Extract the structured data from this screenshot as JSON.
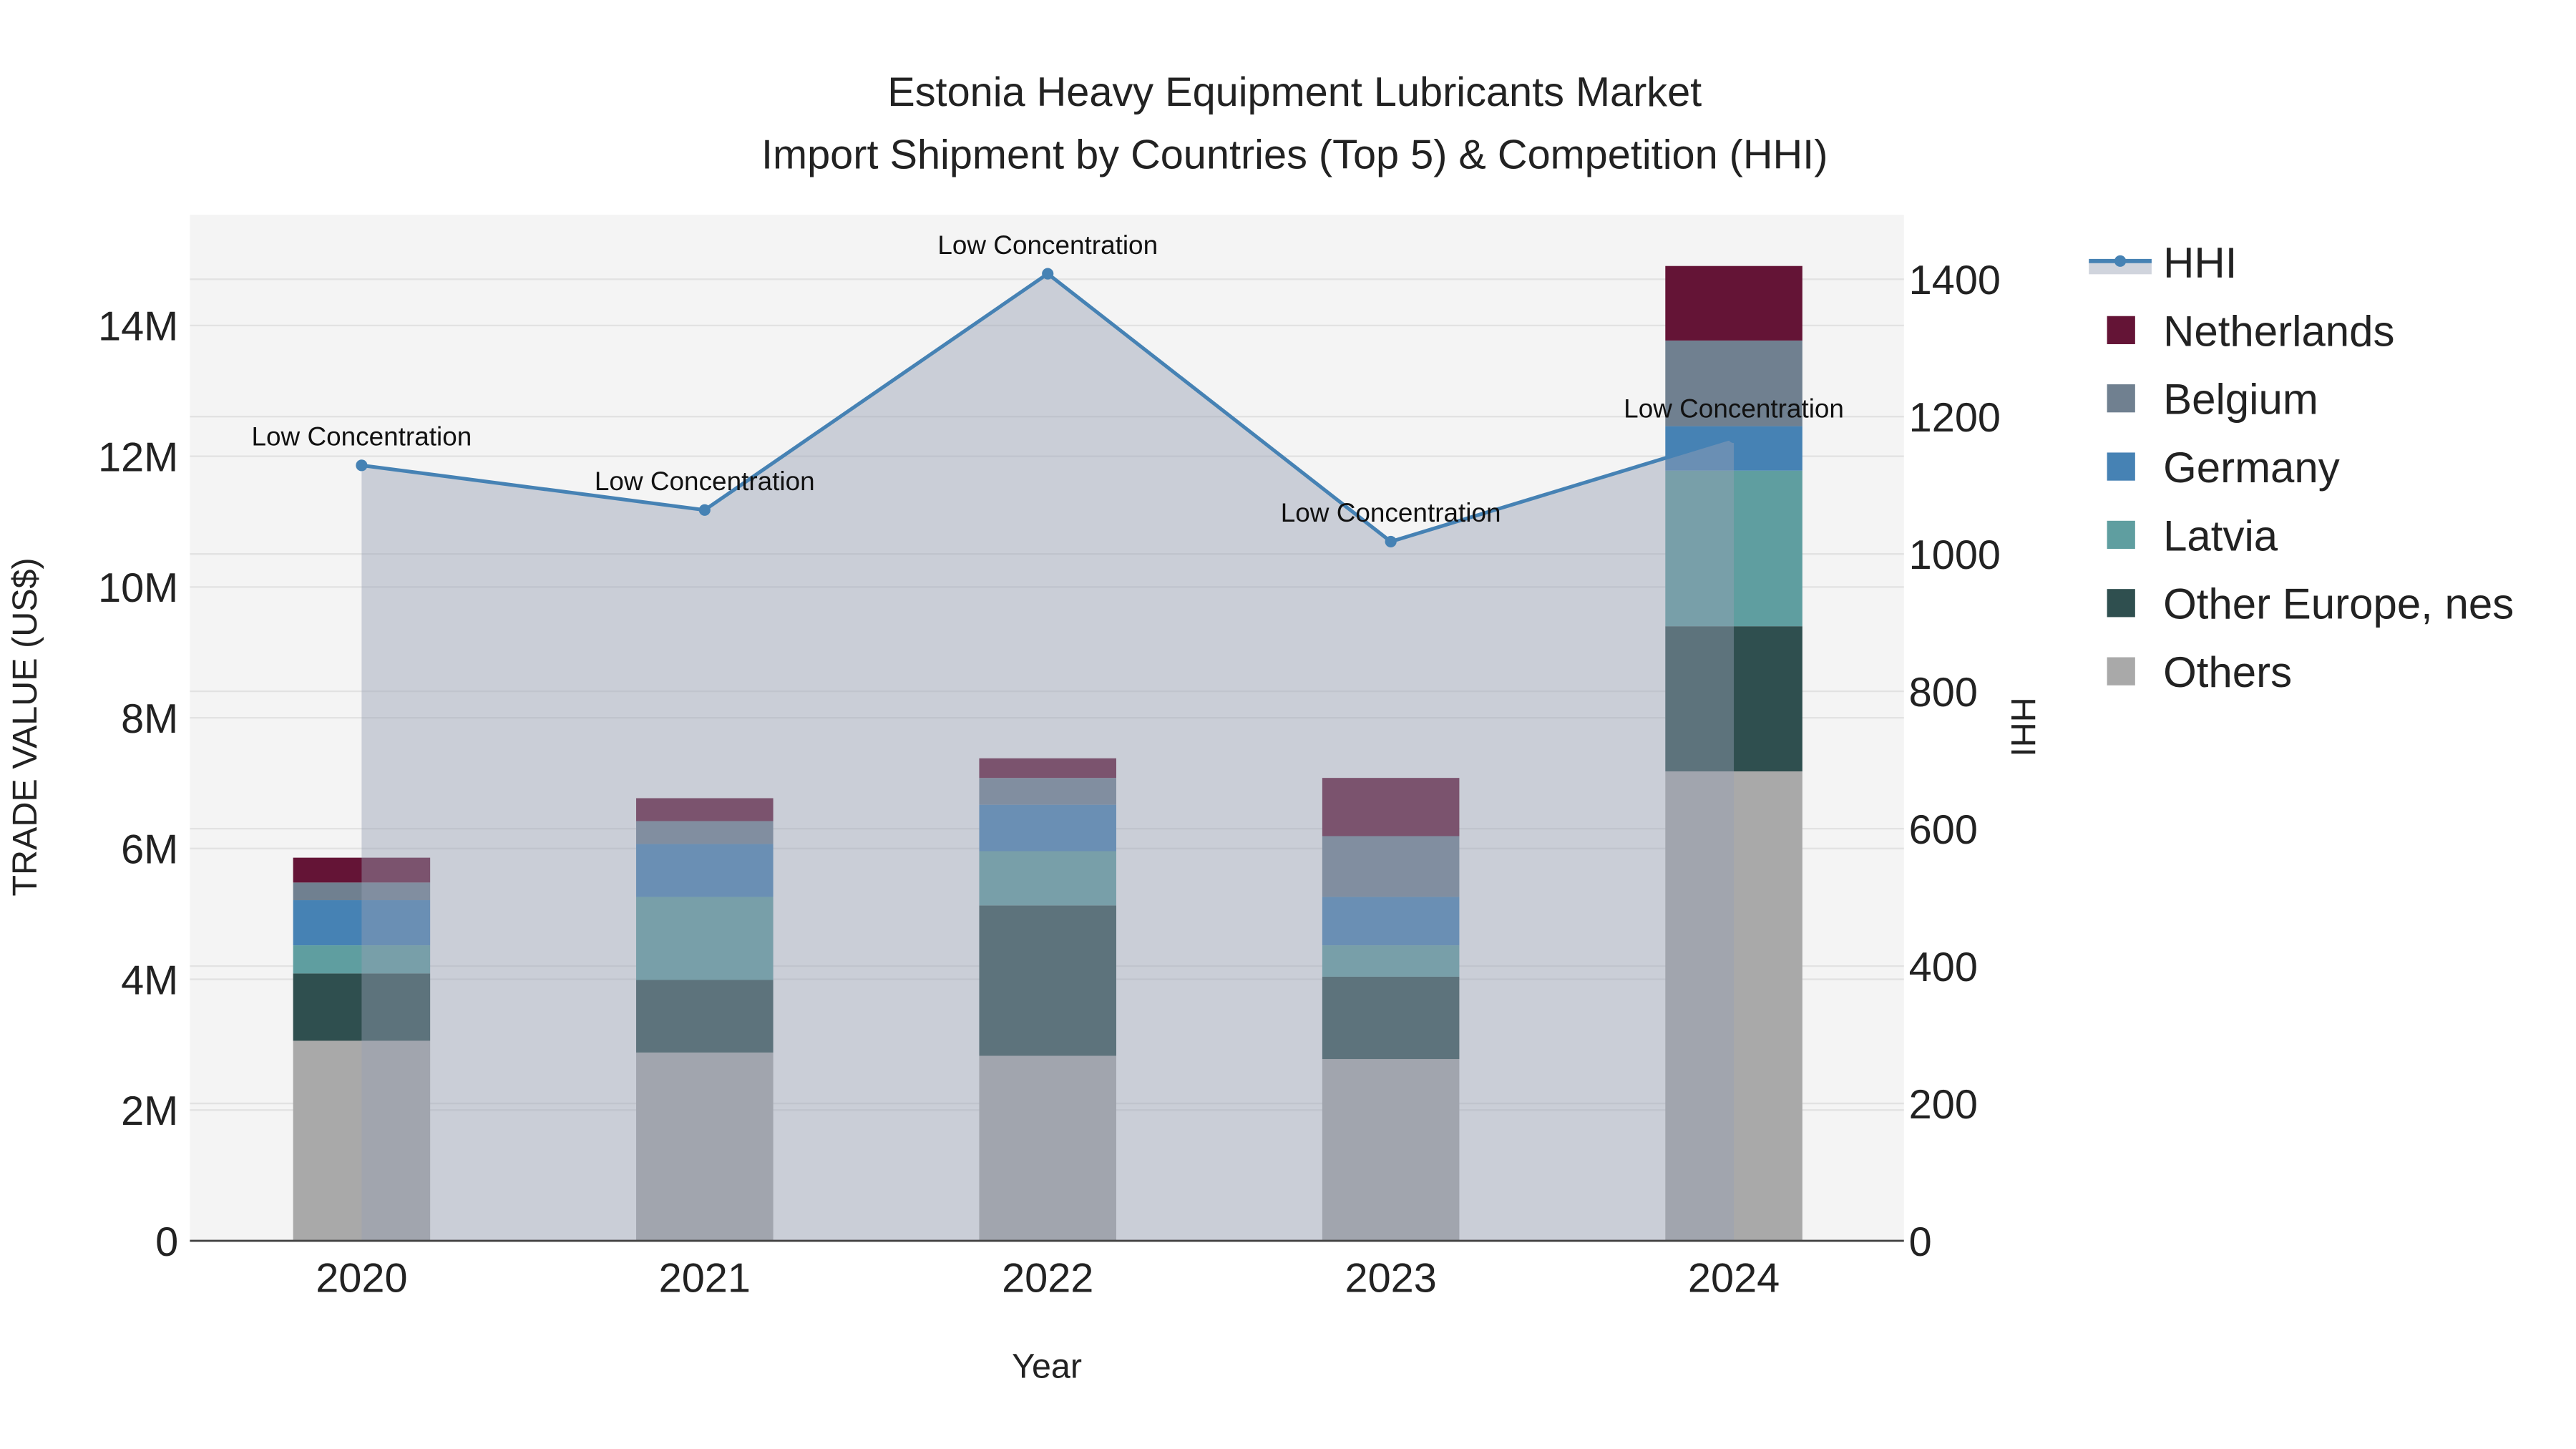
{
  "chart_data": {
    "type": "bar",
    "stacked": true,
    "title": "Estonia Heavy Equipment Lubricants Market",
    "subtitle": "Import Shipment by Countries (Top 5) & Competition (HHI)",
    "xlabel": "Year",
    "ylabel": "TRADE VALUE (US$)",
    "y2label": "HHI",
    "categories": [
      "2020",
      "2021",
      "2022",
      "2023",
      "2024"
    ],
    "ylim": [
      0,
      15500000
    ],
    "y2lim": [
      0,
      1490
    ],
    "yticks": [
      0,
      2000000,
      4000000,
      6000000,
      8000000,
      10000000,
      12000000,
      14000000
    ],
    "ytick_labels": [
      "0",
      "2M",
      "4M",
      "6M",
      "8M",
      "10M",
      "12M",
      "14M"
    ],
    "y2ticks": [
      0,
      200,
      400,
      600,
      800,
      1000,
      1200,
      1400
    ],
    "y2tick_labels": [
      "0",
      "200",
      "400",
      "600",
      "800",
      "1000",
      "1200",
      "1400"
    ],
    "grid": true,
    "legend_position": "right",
    "series": [
      {
        "name": "Others",
        "color": "#A9A9A9",
        "values": [
          3060000,
          2880000,
          2830000,
          2780000,
          7180000
        ]
      },
      {
        "name": "Other Europe, nes",
        "color": "#2F4F4F",
        "values": [
          1030000,
          1110000,
          2300000,
          1260000,
          2220000
        ]
      },
      {
        "name": "Latvia",
        "color": "#5F9EA0",
        "values": [
          430000,
          1270000,
          830000,
          480000,
          2380000
        ]
      },
      {
        "name": "Germany",
        "color": "#4682B4",
        "values": [
          690000,
          810000,
          710000,
          740000,
          680000
        ]
      },
      {
        "name": "Belgium",
        "color": "#708090",
        "values": [
          270000,
          350000,
          410000,
          930000,
          1310000
        ]
      },
      {
        "name": "Netherlands",
        "color": "#641436",
        "values": [
          380000,
          350000,
          300000,
          890000,
          1140000
        ]
      }
    ],
    "line": {
      "name": "HHI",
      "color": "#4682B4",
      "axis": "right",
      "values": [
        1129,
        1064,
        1408,
        1018,
        1170
      ],
      "annotations": [
        "Low Concentration",
        "Low Concentration",
        "Low Concentration",
        "Low Concentration",
        "Low Concentration"
      ]
    },
    "legend_order": [
      "HHI",
      "Netherlands",
      "Belgium",
      "Germany",
      "Latvia",
      "Other Europe, nes",
      "Others"
    ]
  }
}
